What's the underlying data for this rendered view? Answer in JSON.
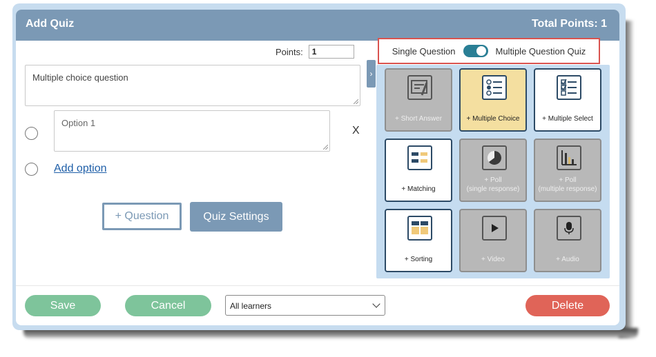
{
  "header": {
    "title": "Add Quiz",
    "total_points": "Total Points: 1"
  },
  "points": {
    "label": "Points:",
    "value": "1"
  },
  "question": {
    "text": "Multiple choice question"
  },
  "options": [
    {
      "text": "Option 1"
    }
  ],
  "remove_option_label": "X",
  "add_option_label": "Add option",
  "actions": {
    "add_question": "+ Question",
    "quiz_settings": "Quiz Settings"
  },
  "mode_toggle": {
    "left_label": "Single Question",
    "right_label": "Multiple Question Quiz",
    "state": "multiple"
  },
  "question_types": [
    {
      "label": "+ Short Answer",
      "icon": "short-answer-icon",
      "state": "disabled"
    },
    {
      "label": "+ Multiple Choice",
      "icon": "multiple-choice-icon",
      "state": "selected"
    },
    {
      "label": "+ Multiple Select",
      "icon": "multiple-select-icon",
      "state": "enabled"
    },
    {
      "label": "+ Matching",
      "icon": "matching-icon",
      "state": "enabled"
    },
    {
      "label": "+ Poll",
      "sublabel": "(single response)",
      "icon": "pie-chart-icon",
      "state": "disabled"
    },
    {
      "label": "+ Poll",
      "sublabel": "(multiple response)",
      "icon": "bar-chart-icon",
      "state": "disabled"
    },
    {
      "label": "+ Sorting",
      "icon": "sorting-icon",
      "state": "enabled"
    },
    {
      "label": "+ Video",
      "icon": "play-icon",
      "state": "disabled"
    },
    {
      "label": "+ Audio",
      "icon": "microphone-icon",
      "state": "disabled"
    }
  ],
  "footer": {
    "save": "Save",
    "cancel": "Cancel",
    "audience": "All learners",
    "delete": "Delete"
  },
  "colors": {
    "header": "#7b99b5",
    "toggle": "#2a7f95",
    "save": "#7ec49b",
    "delete": "#e06458",
    "highlight": "#d9534f",
    "selected_tile": "#f4dfa0"
  }
}
